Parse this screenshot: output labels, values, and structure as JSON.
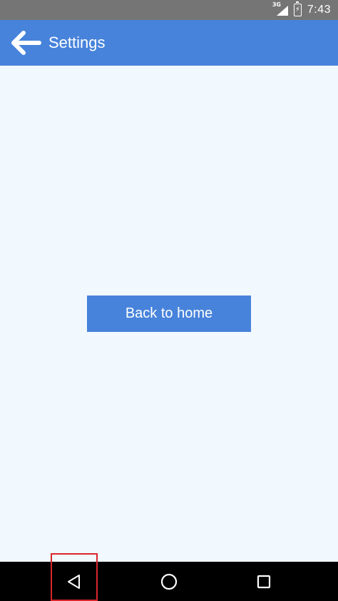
{
  "status_bar": {
    "network_label": "3G",
    "time": "7:43",
    "icons": [
      "signal-icon",
      "battery-charging-icon"
    ]
  },
  "app_bar": {
    "title": "Settings",
    "back_icon": "arrow-left-icon",
    "background_color": "#4783db"
  },
  "main": {
    "home_button_label": "Back to home",
    "background_color": "#f2f9fe"
  },
  "nav_bar": {
    "buttons": [
      "back-triangle-icon",
      "home-circle-icon",
      "recents-square-icon"
    ]
  },
  "colors": {
    "accent": "#4783db",
    "highlight": "#d8262c"
  }
}
